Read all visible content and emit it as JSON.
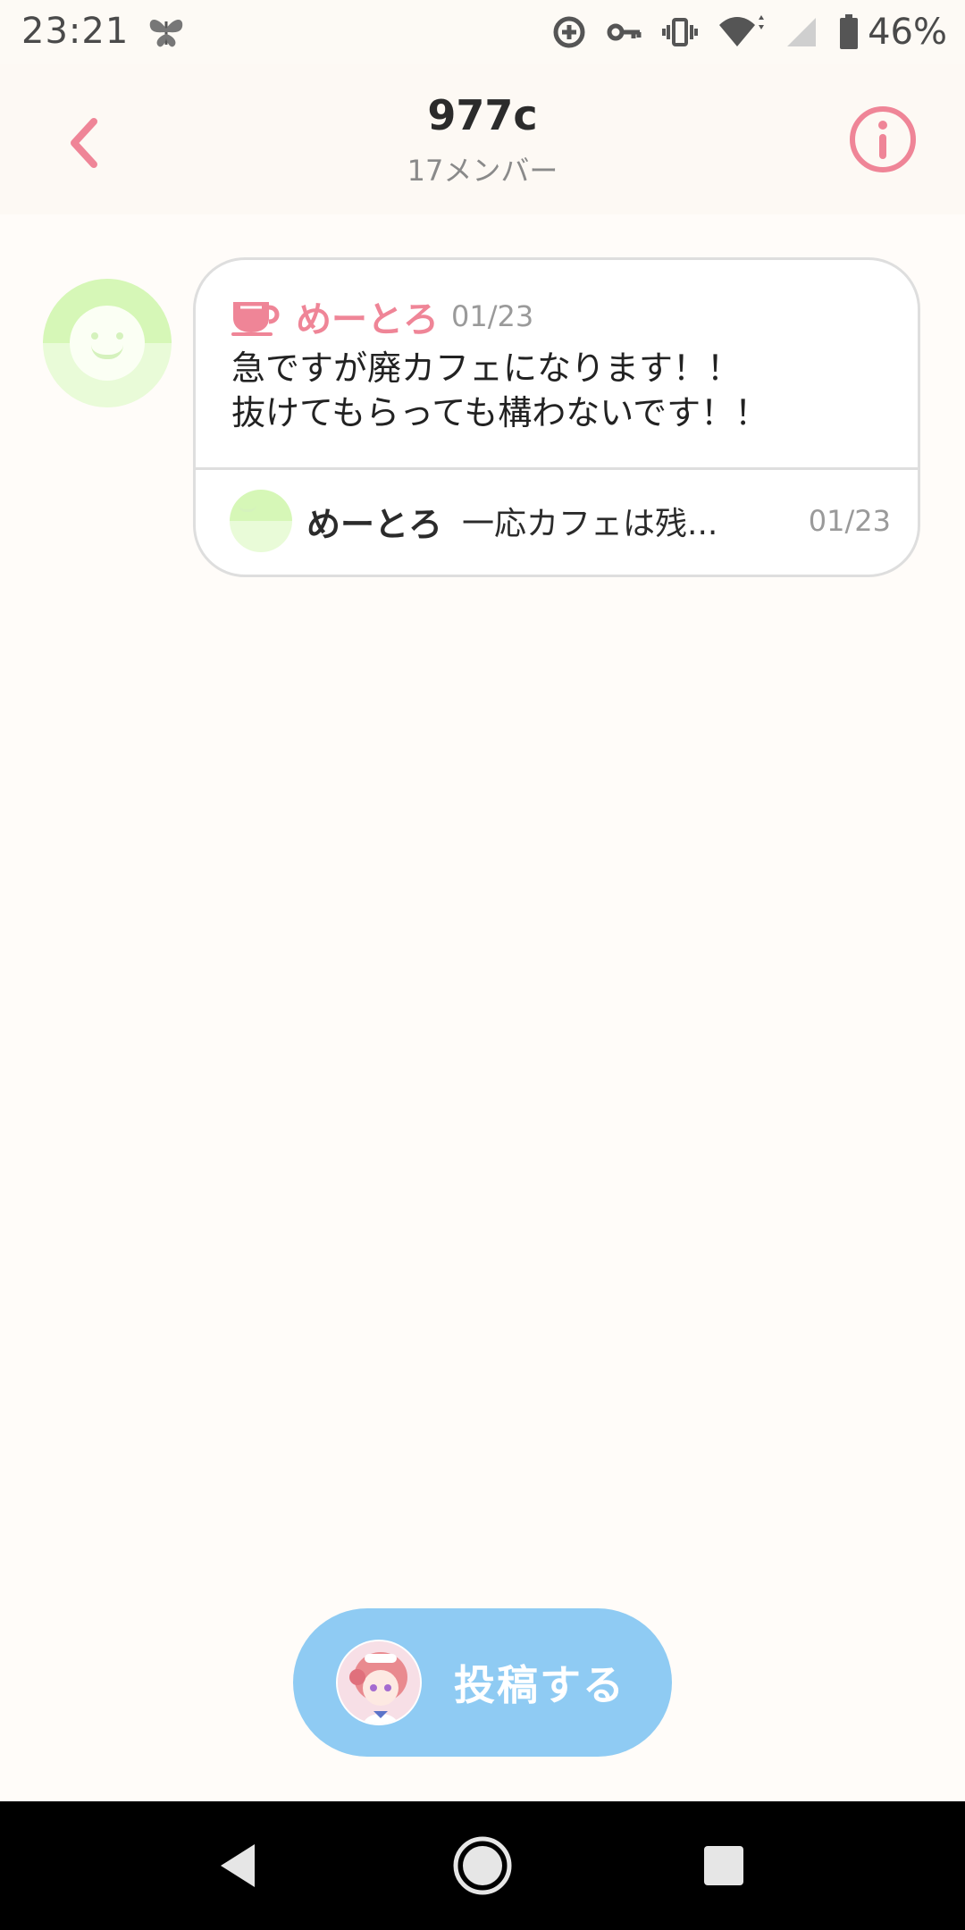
{
  "status_bar": {
    "time": "23:21",
    "battery_text": "46%",
    "icons": [
      "butterfly-icon",
      "data-saver-icon",
      "vpn-key-icon",
      "vibrate-icon",
      "wifi-icon",
      "signal-icon",
      "battery-icon"
    ]
  },
  "header": {
    "title": "977c",
    "subtitle": "17メンバー",
    "back_icon": "chevron-left-icon",
    "info_icon": "info-icon"
  },
  "thread": {
    "author": "めーとろ",
    "date": "01/23",
    "badge_icon": "cup-icon",
    "body_lines": [
      "急ですが廃カフェになります！！",
      "抜けてもらっても構わないです！！"
    ],
    "reply": {
      "author": "めーとろ",
      "preview": "一応カフェは残...",
      "date": "01/23"
    }
  },
  "post_button": {
    "label": "投稿する"
  },
  "nav_bar": {
    "buttons": [
      "back-triangle-icon",
      "home-circle-icon",
      "recents-square-icon"
    ]
  },
  "colors": {
    "accent_pink": "#ef8597",
    "post_blue": "#8fcbf3",
    "avatar_green": "#d6f7b7",
    "background": "#fffcf9"
  }
}
